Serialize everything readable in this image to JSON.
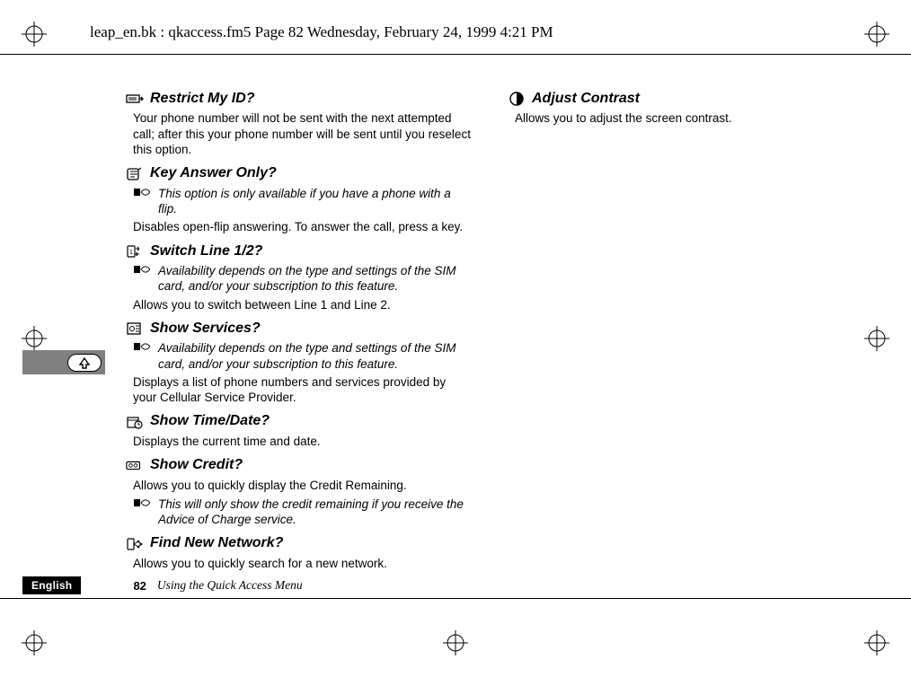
{
  "header": {
    "docpath": "leap_en.bk : qkaccess.fm5  Page 82  Wednesday, February 24, 1999  4:21 PM"
  },
  "left": {
    "s1": {
      "title": "Restrict My ID?",
      "body": "Your phone number will not be sent with the next attempted call; after this your phone number will be sent until you reselect this option."
    },
    "s2": {
      "title": "Key Answer Only?",
      "note": "This option is only available if you have a phone with a flip.",
      "body": "Disables open-flip answering. To answer the call, press a key."
    },
    "s3": {
      "title": "Switch Line 1/2?",
      "note": "Availability depends on the type and settings of the SIM card, and/or your subscription to this feature.",
      "body": "Allows you to switch between Line 1 and Line 2."
    },
    "s4": {
      "title": "Show Services?",
      "note": "Availability depends on the type and settings of the SIM card, and/or your subscription to this feature.",
      "body": "Displays a list of phone numbers and services provided by your Cellular Service Provider."
    },
    "s5": {
      "title": "Show Time/Date?",
      "body": "Displays the current time and date."
    },
    "s6": {
      "title": "Show Credit?",
      "body": "Allows you to quickly display the Credit Remaining.",
      "note": "This will only show the credit remaining if you receive the Advice of Charge service."
    },
    "s7": {
      "title": "Find New Network?",
      "body": "Allows you to quickly search for a new network."
    }
  },
  "right": {
    "s1": {
      "title": "Adjust Contrast",
      "body": "Allows you to adjust the screen contrast."
    }
  },
  "footer": {
    "lang": "English",
    "page": "82",
    "title": "Using the Quick Access Menu"
  }
}
